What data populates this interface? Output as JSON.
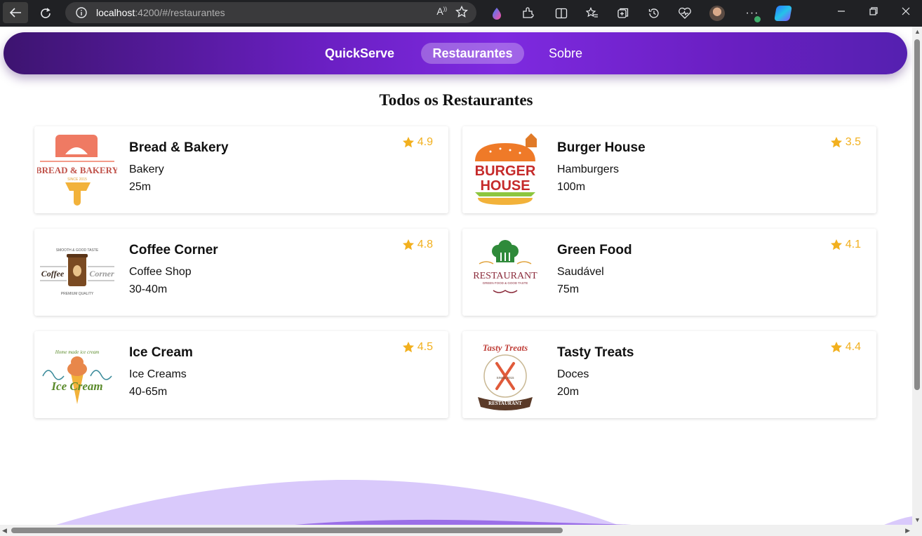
{
  "browser": {
    "url_host": "localhost",
    "url_path": ":4200/#/restaurantes"
  },
  "nav": {
    "brand": "QuickServe",
    "active": "Restaurantes",
    "about": "Sobre"
  },
  "page_title": "Todos os Restaurantes",
  "colors": {
    "accent": "#7e2ae0",
    "star": "#f2b01e",
    "wave": "#d9c9fb"
  },
  "restaurants": [
    {
      "name": "Bread & Bakery",
      "category": "Bakery",
      "time": "25m",
      "rating": "4.9",
      "logo": "bread-bakery-logo",
      "logo_text": "BREAD & BAKERY",
      "logo_sub": "SINCE 2015"
    },
    {
      "name": "Burger House",
      "category": "Hamburgers",
      "time": "100m",
      "rating": "3.5",
      "logo": "burger-house-logo",
      "logo_text": "BURGER",
      "logo_text2": "HOUSE"
    },
    {
      "name": "Coffee Corner",
      "category": "Coffee Shop",
      "time": "30-40m",
      "rating": "4.8",
      "logo": "coffee-corner-logo",
      "logo_text": "Coffee",
      "logo_text2": "Corner",
      "logo_top": "SMOOTH & GOOD TASTE",
      "logo_sub": "PREMIUM QUALITY"
    },
    {
      "name": "Green Food",
      "category": "Saudável",
      "time": "75m",
      "rating": "4.1",
      "logo": "restaurant-chef-logo",
      "logo_text": "RESTAURANT",
      "logo_sub": "GREEN FOOD & GOOD TASTE"
    },
    {
      "name": "Ice Cream",
      "category": "Ice Creams",
      "time": "40-65m",
      "rating": "4.5",
      "logo": "ice-cream-logo",
      "logo_text": "Ice Cream",
      "logo_top": "Home made ice cream"
    },
    {
      "name": "Tasty Treats",
      "category": "Doces",
      "time": "20m",
      "rating": "4.4",
      "logo": "tasty-treats-logo",
      "logo_text": "Tasty Treats",
      "logo_sub": "RESTAURANT",
      "logo_since": "SINCE 2015"
    }
  ]
}
